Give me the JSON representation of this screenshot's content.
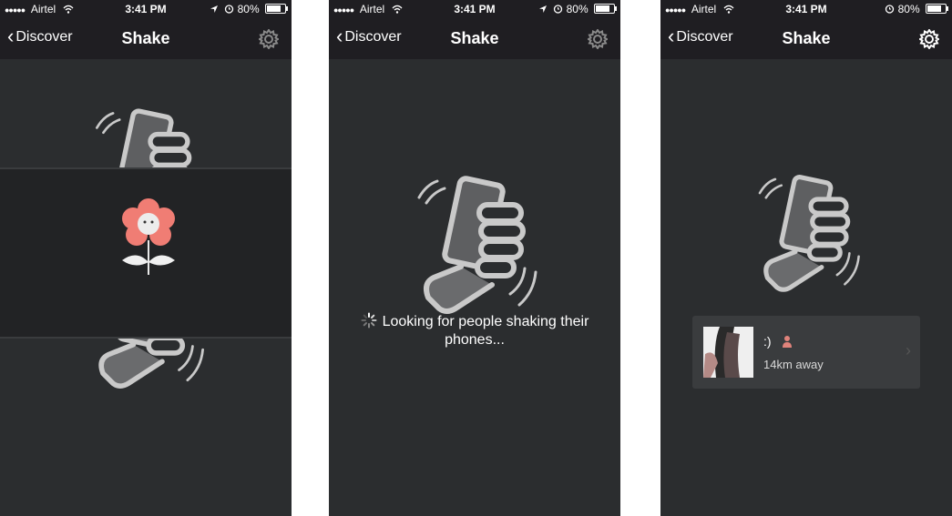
{
  "screens": [
    {
      "status": {
        "carrier": "Airtel",
        "time": "3:41 PM",
        "battery": "80%"
      },
      "nav": {
        "back_label": "Discover",
        "title": "Shake"
      }
    },
    {
      "status": {
        "carrier": "Airtel",
        "time": "3:41 PM",
        "battery": "80%"
      },
      "nav": {
        "back_label": "Discover",
        "title": "Shake"
      },
      "searching_text": "Looking for people shaking their phones..."
    },
    {
      "status": {
        "carrier": "Airtel",
        "time": "3:41 PM",
        "battery": "80%"
      },
      "nav": {
        "back_label": "Discover",
        "title": "Shake"
      },
      "result": {
        "name": ":)",
        "distance": "14km away",
        "gender": "female"
      }
    }
  ],
  "icons": [
    "back-chevron-icon",
    "settings-gear-icon",
    "wifi-icon",
    "location-arrow-icon",
    "alarm-icon",
    "battery-icon",
    "shaking-hand-icon",
    "flower-icon",
    "loading-spinner-icon",
    "female-icon",
    "chevron-right-icon"
  ],
  "colors": {
    "background": "#2b2d2f",
    "navbar": "#1f1e22",
    "card": "#3a3c3e",
    "flower": "#f07d74"
  }
}
